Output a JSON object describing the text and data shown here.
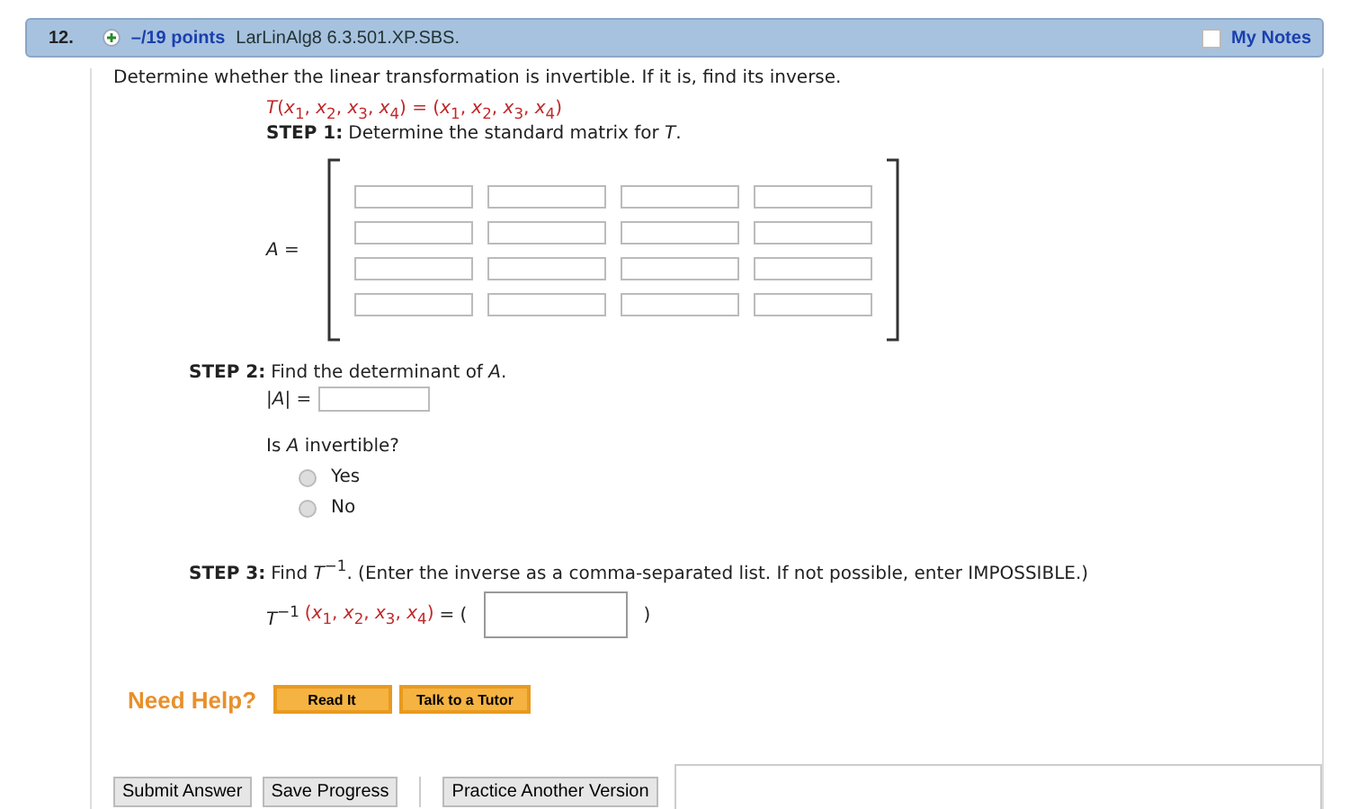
{
  "question": {
    "number": "12.",
    "points": "–/19 points",
    "source": "LarLinAlg8 6.3.501.XP.SBS.",
    "notes": {
      "label": "My Notes",
      "checked": false
    }
  },
  "prompt": "Determine whether the linear transformation is invertible. If it is, find its inverse.",
  "formula": "*T*(*x*$_{1}$, *x*$_{2}$, *x*$_{3}$, *x*$_{4}$) = (*x*$_{1}$, *x*$_{2}$, *x*$_{3}$, *x*$_{4}$)",
  "step1": {
    "label": "STEP 1:",
    "text": "Determine the standard matrix for *T*.",
    "matrix_label": "*A* ="
  },
  "step2": {
    "label": "STEP 2:",
    "text": "Find the determinant of *A*.",
    "det_label": "|*A*| =",
    "question": "Is *A* invertible?",
    "options": [
      {
        "label": "Yes",
        "selected": false
      },
      {
        "label": "No",
        "selected": false
      }
    ]
  },
  "step3": {
    "label": "STEP 3:",
    "text": "Find *T*$^{−1}$. (Enter the inverse as a comma-separated list. If not possible, enter IMPOSSIBLE.)",
    "fn": "*T*$^{−1}$",
    "args": "(*x*$_{1}$, *x*$_{2}$, *x*$_{3}$, *x*$_{4}$)",
    "eq": "= (",
    "close": ")"
  },
  "help": {
    "label": "Need Help?",
    "buttons": [
      "Read It",
      "Talk to a Tutor"
    ]
  },
  "actions": [
    "Submit Answer",
    "Save Progress",
    "Practice Another Version"
  ]
}
